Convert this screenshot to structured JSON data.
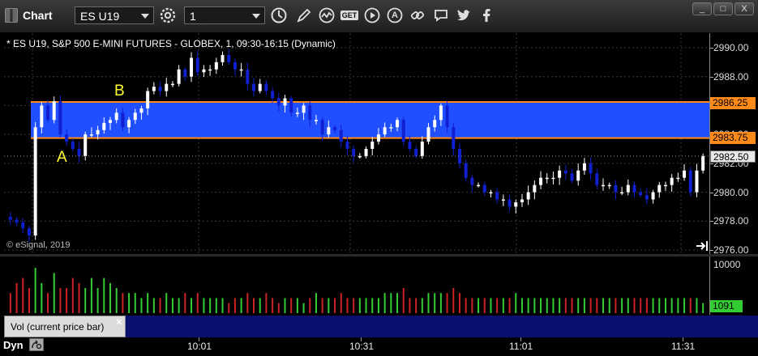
{
  "window": {
    "title": "Chart",
    "symbol": "ES U19",
    "interval": "1",
    "controls": {
      "minimize": "_",
      "restore": "□",
      "close": "X"
    }
  },
  "toolbar_icons": [
    "gear-icon",
    "clock-icon",
    "pencil-icon",
    "chart-wave-icon",
    "get-icon",
    "play-icon",
    "alert-a-icon",
    "link-icon",
    "comment-icon",
    "twitter-icon",
    "facebook-icon"
  ],
  "toolbar_labels": {
    "get": "GET",
    "alert": "A"
  },
  "chart": {
    "title": "* ES U19, S&P 500 E-MINI FUTURES - GLOBEX, 1, 09:30-16:15 (Dynamic)",
    "copyright": "© eSignal, 2019",
    "annotations": {
      "a": "A",
      "b": "B"
    },
    "zone_color": "#1f4fff",
    "zone_line_color": "#ff8a1a",
    "up_color": "#ffffff",
    "down_color": "#1020d0"
  },
  "price_axis": {
    "labels": [
      "2990.00",
      "2988.00",
      "2986.00",
      "2984.00",
      "2982.00",
      "2980.00",
      "2978.00",
      "2976.00"
    ],
    "upper_badge": "2986.25",
    "lower_badge": "2983.75",
    "last_badge": "2982.50"
  },
  "volume": {
    "label": "Vol (current price bar)",
    "close_glyph": "×",
    "axis_max": "10000",
    "axis_min": "0",
    "last_badge": "1091",
    "up_color": "#33cc33",
    "down_color": "#cc2222"
  },
  "status": {
    "dyn": "Dyn"
  },
  "time_axis": [
    "10:01",
    "10:31",
    "11:01",
    "11:31"
  ],
  "chart_data": {
    "type": "candlestick",
    "title": "* ES U19, S&P 500 E-MINI FUTURES - GLOBEX, 1, 09:30-16:15 (Dynamic)",
    "x_ticks": [
      "10:01",
      "10:31",
      "11:01",
      "11:31"
    ],
    "ylim": [
      2976.0,
      2990.0
    ],
    "y_ticks": [
      2976,
      2978,
      2980,
      2982,
      2984,
      2986,
      2988,
      2990
    ],
    "zone": [
      2983.75,
      2986.25
    ],
    "last_price": 2982.5,
    "close": [
      2978.1,
      2977.9,
      2977.5,
      2977.0,
      2984.5,
      2986.0,
      2985.0,
      2986.3,
      2984.0,
      2983.5,
      2983.0,
      2982.5,
      2984.0,
      2984.0,
      2984.3,
      2984.8,
      2985.0,
      2985.5,
      2984.5,
      2985.0,
      2985.5,
      2985.8,
      2987.0,
      2987.3,
      2987.0,
      2987.5,
      2987.5,
      2988.5,
      2988.0,
      2989.3,
      2988.3,
      2988.5,
      2988.5,
      2989.0,
      2989.5,
      2989.0,
      2988.5,
      2988.5,
      2987.5,
      2987.0,
      2987.5,
      2987.0,
      2986.5,
      2986.0,
      2986.5,
      2985.5,
      2985.5,
      2986.0,
      2985.0,
      2985.0,
      2984.0,
      2984.5,
      2984.3,
      2983.5,
      2983.0,
      2982.5,
      2982.5,
      2983.0,
      2983.5,
      2984.0,
      2984.5,
      2984.5,
      2985.0,
      2983.5,
      2983.0,
      2982.5,
      2983.5,
      2984.5,
      2985.0,
      2986.0,
      2984.5,
      2983.0,
      2982.0,
      2981.0,
      2980.5,
      2980.5,
      2980.0,
      2980.0,
      2979.5,
      2979.5,
      2979.0,
      2979.3,
      2979.5,
      2980.0,
      2980.5,
      2981.0,
      2981.0,
      2981.0,
      2981.5,
      2981.3,
      2980.8,
      2981.5,
      2982.0,
      2981.3,
      2980.5,
      2980.5,
      2980.5,
      2980.0,
      2980.0,
      2980.5,
      2980.0,
      2979.8,
      2979.5,
      2980.0,
      2980.5,
      2980.5,
      2981.0,
      2981.0,
      2981.5,
      2980.0,
      2981.5,
      2982.5
    ]
  },
  "vol_data": [
    4,
    6,
    7,
    5,
    9,
    6,
    4,
    8,
    5,
    5,
    7,
    6,
    5,
    7,
    5,
    7,
    6,
    5,
    4,
    4,
    4,
    3,
    4,
    3,
    3,
    4,
    3,
    3,
    4,
    3,
    4,
    3,
    3,
    3,
    3,
    2,
    3,
    3,
    4,
    3,
    3,
    4,
    3,
    2,
    3,
    3,
    3,
    2,
    3,
    4,
    3,
    3,
    3,
    4,
    3,
    3,
    3,
    3,
    3,
    3,
    4,
    4,
    4,
    5,
    3,
    3,
    3,
    4,
    4,
    4,
    4,
    5,
    4,
    3,
    3,
    3,
    3,
    3,
    3,
    3,
    3,
    4,
    3,
    3,
    3,
    3,
    3,
    3,
    3,
    3,
    3,
    3,
    3,
    3,
    3,
    3,
    3,
    3,
    3,
    3,
    3,
    3,
    3,
    3,
    3,
    3,
    3,
    3,
    3,
    3,
    3,
    2
  ]
}
